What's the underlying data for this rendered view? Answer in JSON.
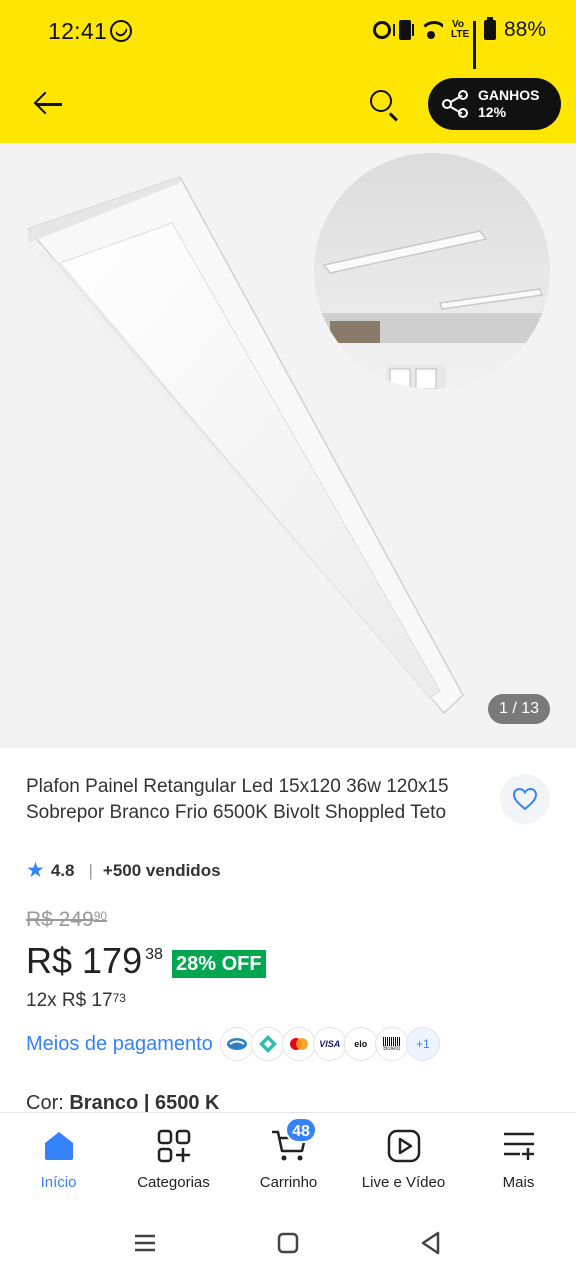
{
  "status_bar": {
    "time": "12:41",
    "battery": "88%",
    "volte": "Vo LTE"
  },
  "header": {
    "gains_line1": "GANHOS",
    "gains_line2": "12%",
    "icons": [
      "back-arrow-icon",
      "search-icon",
      "share-icon"
    ]
  },
  "gallery": {
    "counter": "1 / 13"
  },
  "product": {
    "title": "Plafon Painel Retangular Led 15x120 36w 120x15 Sobrepor Branco Frio 6500K Bivolt Shoppled Teto",
    "rating": "4.8",
    "sold": "+500 vendidos",
    "old_price_int": "R$ 249",
    "old_price_cents": "90",
    "price_int": "R$ 179",
    "price_cents": "38",
    "discount": "28% OFF",
    "installments_int": "12x R$ 17",
    "installments_cents": "73",
    "payment_link": "Meios de pagamento",
    "payment_methods": [
      "card-icon",
      "pix-icon",
      "mastercard-icon",
      "VISA",
      "elo",
      "Boleto"
    ],
    "payment_more": "+1",
    "color_label": "Cor:",
    "color_value": "Branco | 6500 K"
  },
  "bottom_nav": {
    "items": [
      {
        "label": "Início",
        "icon": "home-icon",
        "active": true
      },
      {
        "label": "Categorias",
        "icon": "categories-icon",
        "active": false
      },
      {
        "label": "Carrinho",
        "icon": "cart-icon",
        "active": false
      },
      {
        "label": "Live e Vídeo",
        "icon": "play-icon",
        "active": false
      },
      {
        "label": "Mais",
        "icon": "menu-plus-icon",
        "active": false
      }
    ],
    "cart_count": "48"
  },
  "colors": {
    "brand_yellow": "#ffe600",
    "accent_blue": "#3483fa",
    "discount_green": "#00a650"
  }
}
